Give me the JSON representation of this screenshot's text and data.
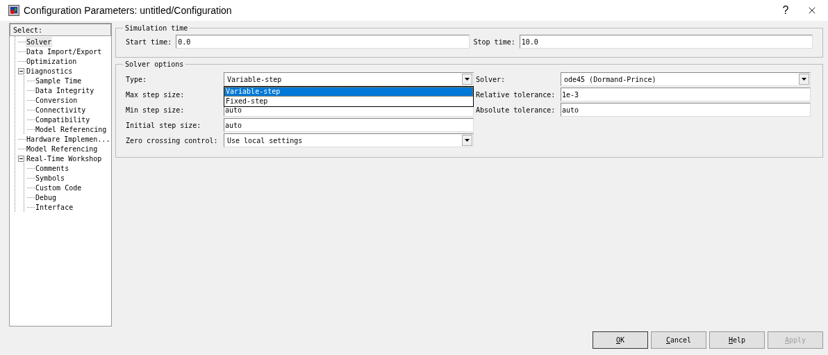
{
  "window": {
    "title": "Configuration Parameters: untitled/Configuration",
    "help": "?"
  },
  "tree": {
    "header": "Select:",
    "items": [
      {
        "label": "Solver",
        "selected": true
      },
      {
        "label": "Data Import/Export",
        "selected": false
      },
      {
        "label": "Optimization",
        "selected": false
      },
      {
        "label": "Diagnostics",
        "selected": false,
        "expanded": true,
        "children": [
          {
            "label": "Sample Time",
            "selected": false
          },
          {
            "label": "Data Integrity",
            "selected": false
          },
          {
            "label": "Conversion",
            "selected": false
          },
          {
            "label": "Connectivity",
            "selected": false
          },
          {
            "label": "Compatibility",
            "selected": false
          },
          {
            "label": "Model Referencing",
            "selected": false
          }
        ]
      },
      {
        "label": "Hardware Implemen...",
        "selected": false
      },
      {
        "label": "Model Referencing",
        "selected": false
      },
      {
        "label": "Real-Time Workshop",
        "selected": false,
        "expanded": true,
        "children": [
          {
            "label": "Comments",
            "selected": false
          },
          {
            "label": "Symbols",
            "selected": false
          },
          {
            "label": "Custom Code",
            "selected": false
          },
          {
            "label": "Debug",
            "selected": false
          },
          {
            "label": "Interface",
            "selected": false
          }
        ]
      }
    ]
  },
  "simulation_time": {
    "title": "Simulation time",
    "fields": [
      {
        "label": "Start time:",
        "value": "0.0"
      },
      {
        "label": "Stop time:",
        "value": "10.0"
      }
    ]
  },
  "solver_options": {
    "title": "Solver options",
    "left": [
      {
        "kind": "dropdown",
        "label": "Type:",
        "value": "Variable-step",
        "open": true,
        "options": [
          {
            "label": "Variable-step",
            "selected": true
          },
          {
            "label": "Fixed-step",
            "selected": false
          }
        ]
      },
      {
        "kind": "hidden",
        "label": "Max step size:"
      },
      {
        "kind": "field",
        "label": "Min step size:",
        "value": "auto"
      },
      {
        "kind": "field",
        "label": "Initial step size:",
        "value": "auto"
      },
      {
        "kind": "dropdown",
        "label": "Zero crossing control:",
        "value": "Use local settings"
      }
    ],
    "right": [
      {
        "kind": "dropdown",
        "label": "Solver:",
        "value": "ode45 (Dormand-Prince)"
      },
      {
        "kind": "field",
        "label": "Relative tolerance:",
        "value": "1e-3"
      },
      {
        "kind": "field",
        "label": "Absolute tolerance:",
        "value": "auto"
      }
    ]
  },
  "buttons": [
    {
      "label": "OK",
      "disabled": false
    },
    {
      "label": "Cancel",
      "disabled": false
    },
    {
      "label": "Help",
      "disabled": false
    },
    {
      "label": "Apply",
      "disabled": true
    }
  ]
}
